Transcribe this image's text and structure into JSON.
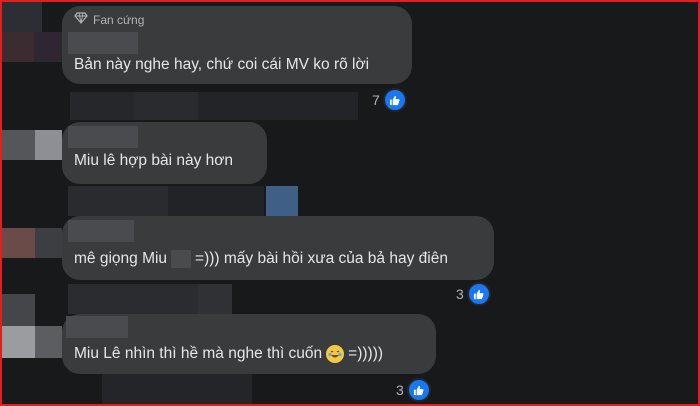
{
  "comments": [
    {
      "badge": "Fan cứng",
      "text": "Bản này nghe hay, chứ coi cái MV ko rõ lời",
      "likes": "7"
    },
    {
      "text": "Miu lê hợp bài này hơn"
    },
    {
      "text_before": "mê giọng Miu",
      "text_after": "=))) mấy bài hồi xưa của bả hay điên",
      "likes": "3"
    },
    {
      "text_before": "Miu Lê nhìn thì hề mà nghe thì cuốn",
      "text_after": "=)))))",
      "likes": "3",
      "emoji": "crying-laughing-emoji"
    }
  ],
  "colors": {
    "background": "#18191a",
    "bubble": "#3a3b3c",
    "text": "#e4e6eb",
    "like": "#1877f2",
    "border": "#e02020"
  }
}
